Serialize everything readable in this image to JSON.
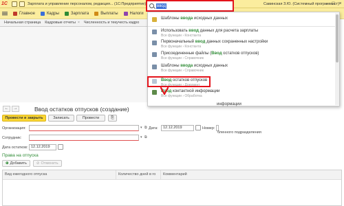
{
  "app": {
    "title": "Зарплата и управление персоналом, редакция... (1С:Предприятие)",
    "user": "Савинская З.Ю. (Системный программист)"
  },
  "menu": {
    "items": [
      {
        "label": "Главное",
        "color": "#c0392b"
      },
      {
        "label": "Кадры",
        "color": "#3b6fd8"
      },
      {
        "label": "Зарплата",
        "color": "#2e8b35"
      },
      {
        "label": "Выплаты",
        "color": "#d08b16"
      },
      {
        "label": "Налоги",
        "color": "#8e44ad"
      }
    ]
  },
  "tabs": [
    {
      "label": "Начальная страница"
    },
    {
      "label": "Кадровые отчеты"
    },
    {
      "label": "Численность и текучесть кадро"
    }
  ],
  "search": {
    "value": "ввод"
  },
  "dropdown": {
    "header": {
      "pre": "Шаблоны ",
      "hl": "ввода",
      "post": " исходных данных"
    },
    "items": [
      {
        "pre": "Использовать ",
        "hl": "ввод",
        "post": " данных для расчета зарплаты",
        "sub": "Все функции › Константа"
      },
      {
        "pre": "Первоначальный ",
        "hl": "ввод",
        "post": " данных сохраненных настройки",
        "sub": "Все функции › Константа"
      },
      {
        "pre": "Присоединенные файлы (",
        "hl": "Ввод",
        "post": " остатков отпусков)",
        "sub": "Все функции › Справочник"
      },
      {
        "pre": "Шаблоны ",
        "hl": "ввода",
        "post": " исходных данных",
        "sub": "Все функции › Справочник"
      },
      {
        "pre": "",
        "hl": "Ввод",
        "post": " остатков отпусков",
        "sub": "Все функции › Документ"
      },
      {
        "pre": "",
        "hl": "Ввод",
        "post": " контактной информации",
        "sub": "Все функции › Обработка"
      }
    ],
    "tail": "информации"
  },
  "form": {
    "title": "Ввод остатков отпусков (создание)",
    "buttons": {
      "post_close": "Провести и закрыть",
      "save": "Записать",
      "post": "Провести"
    },
    "org_label": "Организация:",
    "employee_label": "Сотрудник:",
    "date_label": "Дата:",
    "date_value": "12.12.2019",
    "number_label": "Номер:",
    "number_note": "бленного подразделения",
    "balance_date_label": "Дата остатков:",
    "balance_date_value": "12.12.2019"
  },
  "section": {
    "title": "Права на отпуска",
    "add": "Добавить",
    "cancel": "Отменить"
  },
  "table": {
    "columns": [
      "Вид ежегодного отпуска",
      "Количество дней в го",
      "Комментарий"
    ]
  }
}
